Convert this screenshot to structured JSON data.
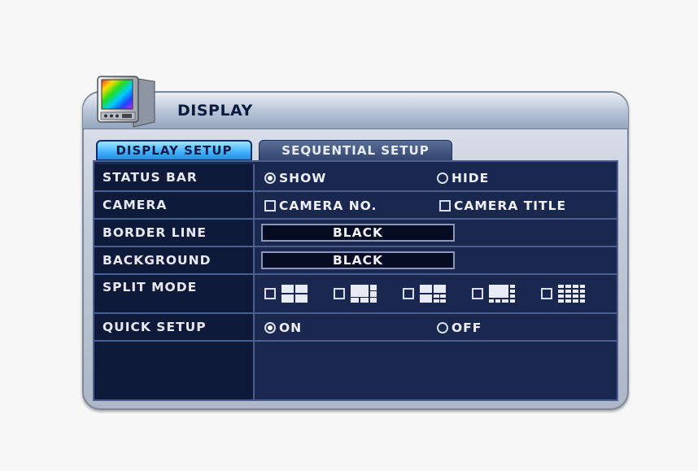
{
  "window": {
    "title": "DISPLAY"
  },
  "tabs": [
    {
      "label": "DISPLAY SETUP",
      "active": true
    },
    {
      "label": "SEQUENTIAL SETUP",
      "active": false
    }
  ],
  "rows": {
    "status_bar": {
      "label": "STATUS BAR",
      "options": [
        {
          "label": "SHOW",
          "selected": true
        },
        {
          "label": "HIDE",
          "selected": false
        }
      ]
    },
    "camera": {
      "label": "CAMERA",
      "options": [
        {
          "label": "CAMERA NO.",
          "checked": false
        },
        {
          "label": "CAMERA TITLE",
          "checked": false
        }
      ]
    },
    "border_line": {
      "label": "BORDER LINE",
      "value": "BLACK"
    },
    "background": {
      "label": "BACKGROUND",
      "value": "BLACK"
    },
    "split_mode": {
      "label": "SPLIT MODE",
      "layouts": [
        "quad-4",
        "split-6",
        "split-8",
        "split-10",
        "grid-16"
      ]
    },
    "quick_setup": {
      "label": "QUICK SETUP",
      "options": [
        {
          "label": "ON",
          "selected": true
        },
        {
          "label": "OFF",
          "selected": false
        }
      ]
    }
  },
  "colors": {
    "panel": "#1a2850",
    "label_cell": "#0f1a3a",
    "tab_active": "#3fb0ff",
    "tab_inactive": "#33466f"
  },
  "icons": {
    "window": "monitor-icon"
  }
}
